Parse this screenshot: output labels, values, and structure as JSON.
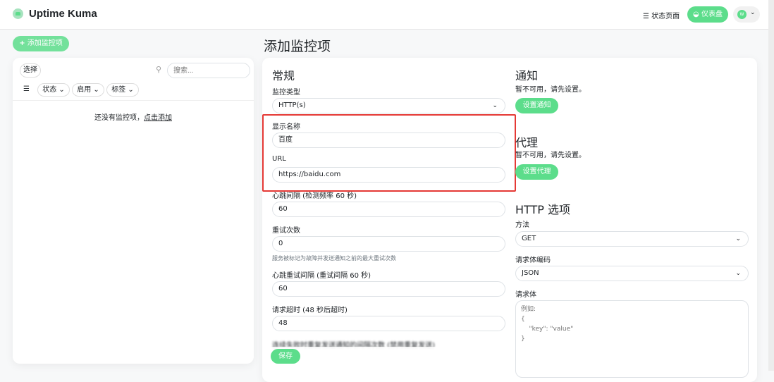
{
  "header": {
    "brand": "Uptime Kuma",
    "status_page": "状态页面",
    "dashboard": "仪表盘",
    "avatar": "W"
  },
  "sidebar": {
    "add_button": "添加监控项",
    "select": "选择",
    "search_placeholder": "搜索...",
    "filters": [
      "状态",
      "启用",
      "标签"
    ],
    "empty_text": "还没有监控项，",
    "empty_link": "点击添加"
  },
  "main": {
    "title": "添加监控项",
    "general": {
      "heading": "常规",
      "monitor_type_label": "监控类型",
      "monitor_type": "HTTP(s)",
      "name_label": "显示名称",
      "name_value": "百度",
      "url_label": "URL",
      "url_value": "https://baidu.com",
      "interval_label": "心跳间隔 (检测频率 60 秒)",
      "interval_value": "60",
      "retries_label": "重试次数",
      "retries_value": "0",
      "retries_help": "服务被标记为故障并发送通知之前的最大重试次数",
      "retry_interval_label": "心跳重试间隔 (重试间隔 60 秒)",
      "retry_interval_value": "60",
      "timeout_label": "请求超时 (48 秒后超时)",
      "timeout_value": "48",
      "resend_label": "连续失败时重复发送通知的间隔次数 (禁用重复发送)",
      "save": "保存"
    },
    "notification": {
      "heading": "通知",
      "text": "暂不可用，请先设置。",
      "button": "设置通知"
    },
    "proxy": {
      "heading": "代理",
      "text": "暂不可用，请先设置。",
      "button": "设置代理"
    },
    "http": {
      "heading": "HTTP 选项",
      "method_label": "方法",
      "method": "GET",
      "encoding_label": "请求体编码",
      "encoding": "JSON",
      "body_label": "请求体",
      "body_placeholder": "例如:\n{\n    \"key\": \"value\"\n}"
    }
  },
  "colors": {
    "accent": "#5cdd8b",
    "highlight": "#e53935"
  }
}
